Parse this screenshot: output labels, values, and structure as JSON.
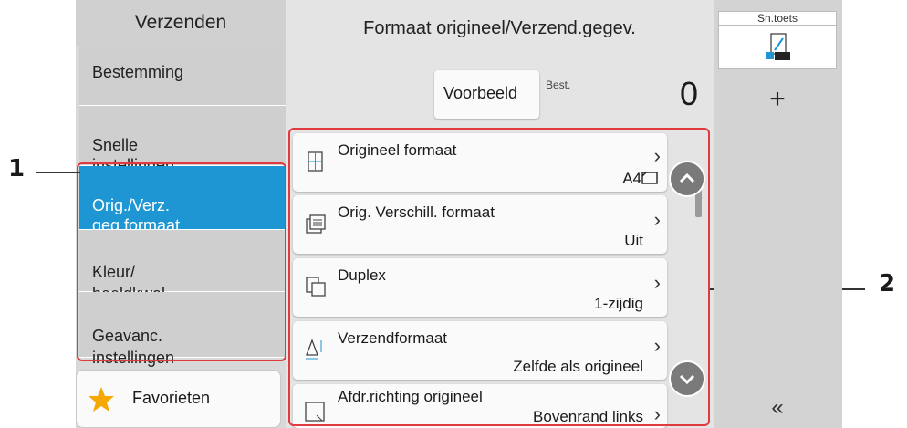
{
  "left_nav": {
    "title": "Verzenden",
    "items": [
      {
        "label": "Bestemming"
      },
      {
        "label": "Snelle\ninstellingen"
      },
      {
        "label": "Orig./Verz.\ngeg.formaat"
      },
      {
        "label": "Kleur/\nbeeldkwal."
      },
      {
        "label": "Geavanc.\ninstellingen"
      }
    ],
    "favorites_label": "Favorieten"
  },
  "header": {
    "title": "Formaat origineel/Verzend.gegev.",
    "preview_button": "Voorbeeld",
    "dest_label": "Best.",
    "dest_count": "0"
  },
  "settings": [
    {
      "label": "Origineel formaat",
      "value": "A4",
      "icon": "original-size-icon"
    },
    {
      "label": "Orig. Verschill. formaat",
      "value": "Uit",
      "icon": "mixed-size-icon"
    },
    {
      "label": "Duplex",
      "value": "1-zijdig",
      "icon": "duplex-icon"
    },
    {
      "label": "Verzendformaat",
      "value": "Zelfde als origineel",
      "icon": "send-size-icon"
    },
    {
      "label": "Afdr.richting origineel",
      "value": "Bovenrand links",
      "icon": "orientation-icon"
    }
  ],
  "right_panel": {
    "shortcut_label": "Sn.toets",
    "add_label": "+",
    "collapse_label": "«"
  },
  "callouts": {
    "one": "1",
    "two": "2"
  },
  "colors": {
    "selected": "#1e96d3",
    "callout": "#e0393e",
    "scroll_button": "#7a7a7a"
  }
}
